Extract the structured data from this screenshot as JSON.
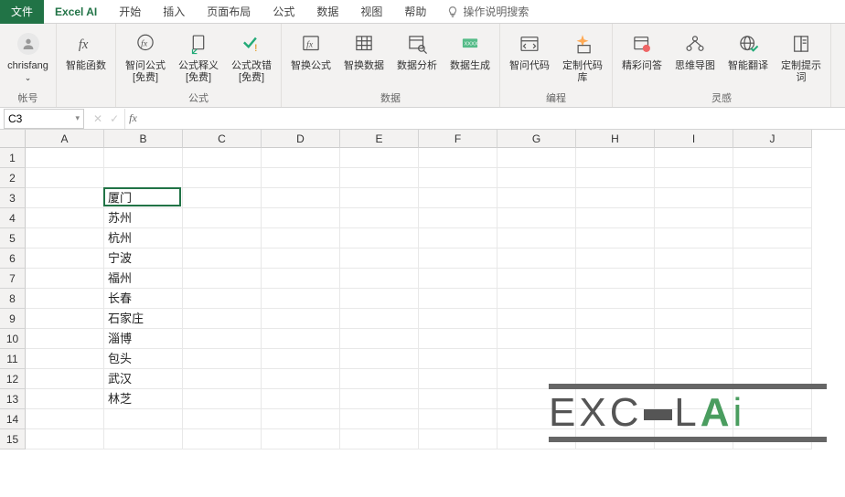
{
  "tabs": {
    "file": "文件",
    "active": "Excel AI",
    "items": [
      "开始",
      "插入",
      "页面布局",
      "公式",
      "数据",
      "视图",
      "帮助"
    ],
    "tellme_icon": "lightbulb-icon",
    "tellme": "操作说明搜索"
  },
  "ribbon": {
    "account": {
      "name": "chrisfang",
      "label": "帐号"
    },
    "groups": [
      {
        "label": "",
        "buttons": [
          {
            "icon": "fx-icon",
            "l1": "智能函数",
            "l2": ""
          }
        ]
      },
      {
        "label": "公式",
        "buttons": [
          {
            "icon": "fx-question-icon",
            "l1": "智问公式",
            "l2": "[免费]"
          },
          {
            "icon": "doc-arrow-icon",
            "l1": "公式释义",
            "l2": "[免费]"
          },
          {
            "icon": "check-exclaim-icon",
            "l1": "公式改错",
            "l2": "[免费]"
          }
        ]
      },
      {
        "label": "数据",
        "buttons": [
          {
            "icon": "fx-box-icon",
            "l1": "智换公式",
            "l2": ""
          },
          {
            "icon": "grid-swap-icon",
            "l1": "智换数据",
            "l2": ""
          },
          {
            "icon": "table-search-icon",
            "l1": "数据分析",
            "l2": ""
          },
          {
            "icon": "xxxx-icon",
            "l1": "数据生成",
            "l2": ""
          }
        ]
      },
      {
        "label": "编程",
        "buttons": [
          {
            "icon": "code-window-icon",
            "l1": "智问代码",
            "l2": ""
          },
          {
            "icon": "sparkle-code-icon",
            "l1": "定制代码库",
            "l2": ""
          }
        ]
      },
      {
        "label": "灵感",
        "buttons": [
          {
            "icon": "calendar-chat-icon",
            "l1": "精彩问答",
            "l2": ""
          },
          {
            "icon": "mindmap-icon",
            "l1": "思维导图",
            "l2": ""
          },
          {
            "icon": "globe-check-icon",
            "l1": "智能翻译",
            "l2": ""
          },
          {
            "icon": "book-note-icon",
            "l1": "定制提示词",
            "l2": ""
          }
        ]
      }
    ]
  },
  "namebox": {
    "ref": "C3",
    "fx": "fx"
  },
  "columns": [
    "A",
    "B",
    "C",
    "D",
    "E",
    "F",
    "G",
    "H",
    "I",
    "J"
  ],
  "rows": [
    "1",
    "2",
    "3",
    "4",
    "5",
    "6",
    "7",
    "8",
    "9",
    "10",
    "11",
    "12",
    "13",
    "14",
    "15"
  ],
  "cells": {
    "B3": "厦门",
    "B4": "苏州",
    "B5": "杭州",
    "B6": "宁波",
    "B7": "福州",
    "B8": "长春",
    "B9": "石家庄",
    "B10": "淄博",
    "B11": "包头",
    "B12": "武汉",
    "B13": "林芝"
  },
  "active": {
    "col": 2,
    "row": 3
  },
  "watermark": {
    "text1": "EXC",
    "text2": "E",
    "text3": "L",
    "text4": "A",
    "text5": "i"
  }
}
